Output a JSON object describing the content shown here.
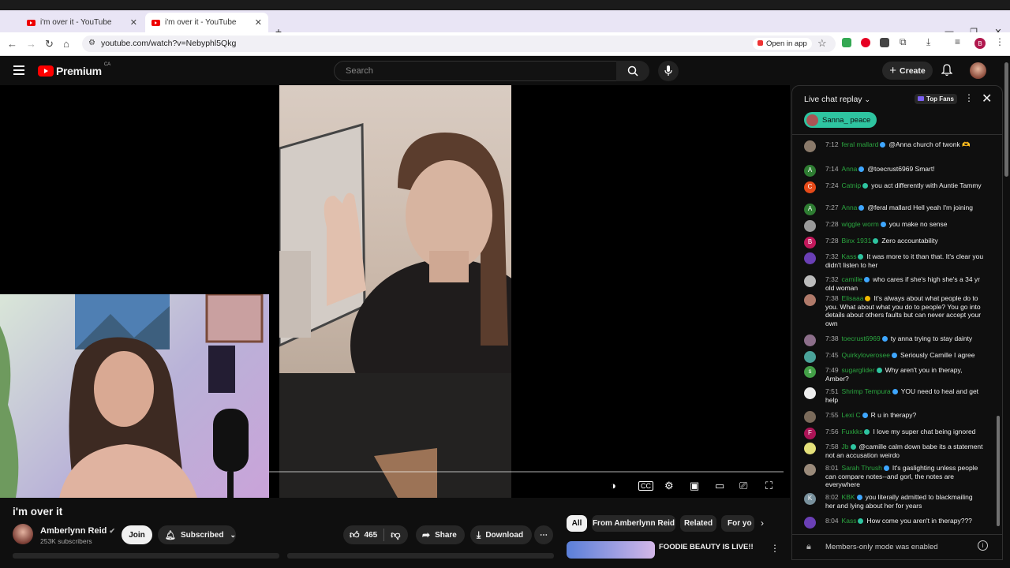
{
  "browser": {
    "tabs": [
      {
        "title": "i'm over it - YouTube"
      },
      {
        "title": "i'm over it - YouTube"
      }
    ],
    "url": "youtube.com/watch?v=Nebyphl5Qkg",
    "open_in_app": "Open in app",
    "profile_initial": "B"
  },
  "header": {
    "logo_text": "Premium",
    "region": "CA",
    "search_placeholder": "Search",
    "create_label": "Create"
  },
  "video": {
    "title": "i'm over it",
    "channel": "Amberlynn Reid",
    "subscribers": "253K subscribers",
    "join_label": "Join",
    "subscribed_label": "Subscribed",
    "likes": "465",
    "share_label": "Share",
    "download_label": "Download"
  },
  "chips": [
    "All",
    "From Amberlynn Reid",
    "Related",
    "For yo"
  ],
  "recommendation": {
    "title": "FOODIE BEAUTY IS LIVE!!"
  },
  "chat": {
    "title": "Live chat replay",
    "top_fans": "Top Fans",
    "pinned_user": "Sanna_ peace",
    "footer": "Members-only mode was enabled",
    "colors": {
      "author": "#2ba640",
      "pinned": "#2ec4a0"
    },
    "messages": [
      {
        "avatar": "",
        "avcolor": "#8a7a6a",
        "time": "7:12",
        "author": "feral mallard",
        "badge": "#3ea6ff",
        "text": "@Anna church of twonk 🫶"
      },
      {
        "avatar": "A",
        "avcolor": "#2e7d32",
        "time": "7:14",
        "author": "Anna",
        "badge": "#3ea6ff",
        "text": "@toecrust6969 Smart!"
      },
      {
        "avatar": "C",
        "avcolor": "#e64a19",
        "time": "7:24",
        "author": "Catnip",
        "badge": "#2ec4a0",
        "text": "you act differently with Auntie Tammy"
      },
      {
        "avatar": "A",
        "avcolor": "#2e7d32",
        "time": "7:27",
        "author": "Anna",
        "badge": "#3ea6ff",
        "text": "@feral mallard Hell yeah I'm joining"
      },
      {
        "avatar": "",
        "avcolor": "#9a9a9a",
        "time": "7:28",
        "author": "wiggle worm",
        "badge": "#3ea6ff",
        "text": "you make no sense"
      },
      {
        "avatar": "B",
        "avcolor": "#c2185b",
        "time": "7:28",
        "author": "Binx 1931",
        "badge": "#2ec4a0",
        "text": "Zero accountability"
      },
      {
        "avatar": "",
        "avcolor": "#6a3fb5",
        "time": "7:32",
        "author": "Kass",
        "badge": "#2ec4a0",
        "text": "It was more to it than that. It's clear you didn't listen to her"
      },
      {
        "avatar": "",
        "avcolor": "#bbbbbb",
        "time": "7:32",
        "author": "camille",
        "badge": "#3ea6ff",
        "text": "who cares if she's high she's a 34 yr old woman"
      },
      {
        "avatar": "",
        "avcolor": "#b07a6a",
        "time": "7:38",
        "author": "Elisaaa",
        "badge": "#f2b900",
        "text": "It's always about what people do to you. What about what you do to people? You go into details about others faults but can never accept your own"
      },
      {
        "avatar": "",
        "avcolor": "#8c6e8a",
        "time": "7:38",
        "author": "toecrust6969",
        "badge": "#3ea6ff",
        "text": "ty anna trying to stay dainty"
      },
      {
        "avatar": "",
        "avcolor": "#4aa39a",
        "time": "7:45",
        "author": "Quirkyloverosee",
        "badge": "#3ea6ff",
        "text": "Seriously Camille I agree"
      },
      {
        "avatar": "s",
        "avcolor": "#43a047",
        "time": "7:49",
        "author": "sugarglider",
        "badge": "#2ec4a0",
        "text": "Why aren't you in therapy, Amber?"
      },
      {
        "avatar": "",
        "avcolor": "#eeeeee",
        "time": "7:51",
        "author": "Shrimp Tempura",
        "badge": "#3ea6ff",
        "text": "YOU need to heal and get help"
      },
      {
        "avatar": "",
        "avcolor": "#7a6a5a",
        "time": "7:55",
        "author": "Lexi C",
        "badge": "#3ea6ff",
        "text": "R u in therapy?"
      },
      {
        "avatar": "F",
        "avcolor": "#ad1457",
        "time": "7:56",
        "author": "Fuxkks",
        "badge": "#2ec4a0",
        "text": "I love my super chat being ignored"
      },
      {
        "avatar": "",
        "avcolor": "#e4e07a",
        "time": "7:58",
        "author": "Jb",
        "badge": "#2ec4a0",
        "text": "@camille calm down babe its a statement not an accusation weirdo"
      },
      {
        "avatar": "",
        "avcolor": "#9a8a7a",
        "time": "8:01",
        "author": "Sarah Thrush",
        "badge": "#3ea6ff",
        "text": "It's gaslighting unless people can compare notes--and gorl, the notes are everywhere"
      },
      {
        "avatar": "K",
        "avcolor": "#78909c",
        "time": "8:02",
        "author": "KBK",
        "badge": "#3ea6ff",
        "text": "you literally admitted to blackmailing her and lying about her for years"
      },
      {
        "avatar": "",
        "avcolor": "#6a3fb5",
        "time": "8:04",
        "author": "Kass",
        "badge": "#2ec4a0",
        "text": "How come you aren't in therapy???"
      }
    ]
  }
}
